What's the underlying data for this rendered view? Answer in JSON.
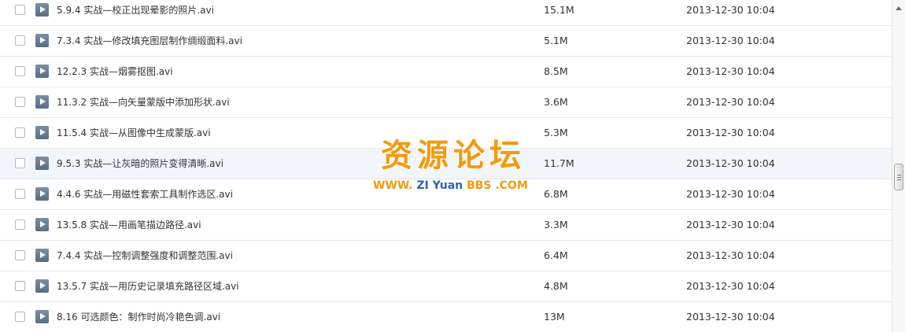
{
  "files": [
    {
      "name": "5.9.4 实战—校正出现晕影的照片.avi",
      "size": "15.1M",
      "date": "2013-12-30 10:04"
    },
    {
      "name": "7.3.4 实战—修改填充图层制作绸缎面料.avi",
      "size": "5.1M",
      "date": "2013-12-30 10:04"
    },
    {
      "name": "12.2.3 实战—烟雾抠图.avi",
      "size": "8.5M",
      "date": "2013-12-30 10:04"
    },
    {
      "name": "11.3.2 实战—向矢量蒙版中添加形状.avi",
      "size": "3.6M",
      "date": "2013-12-30 10:04"
    },
    {
      "name": "11.5.4 实战—从图像中生成蒙版.avi",
      "size": "5.3M",
      "date": "2013-12-30 10:04"
    },
    {
      "name": "9.5.3 实战—让灰暗的照片变得清晰.avi",
      "size": "11.7M",
      "date": "2013-12-30 10:04"
    },
    {
      "name": "4.4.6 实战—用磁性套索工具制作选区.avi",
      "size": "6.8M",
      "date": "2013-12-30 10:04"
    },
    {
      "name": "13.5.8 实战—用画笔描边路径.avi",
      "size": "3.3M",
      "date": "2013-12-30 10:04"
    },
    {
      "name": "7.4.4 实战—控制调整强度和调整范围.avi",
      "size": "6.4M",
      "date": "2013-12-30 10:04"
    },
    {
      "name": "13.5.7 实战—用历史记录填充路径区域.avi",
      "size": "4.8M",
      "date": "2013-12-30 10:04"
    },
    {
      "name": "8.16 可选颜色：制作时尚冷艳色调.avi",
      "size": "13M",
      "date": "2013-12-30 10:04"
    }
  ],
  "hovered_index": 5,
  "icons": {
    "row_icon": "video-file-icon"
  },
  "watermark": {
    "main": "资源论坛",
    "sub_www": "WWW.",
    "sub_zi": "ZI",
    "sub_yuan": "Yuan",
    "sub_bbs": "BBS",
    "sub_com": ".COM"
  },
  "colors": {
    "watermark_orange": "#f29a10",
    "watermark_blue": "#2a64b4",
    "hover_row": "#f2f6fb"
  }
}
